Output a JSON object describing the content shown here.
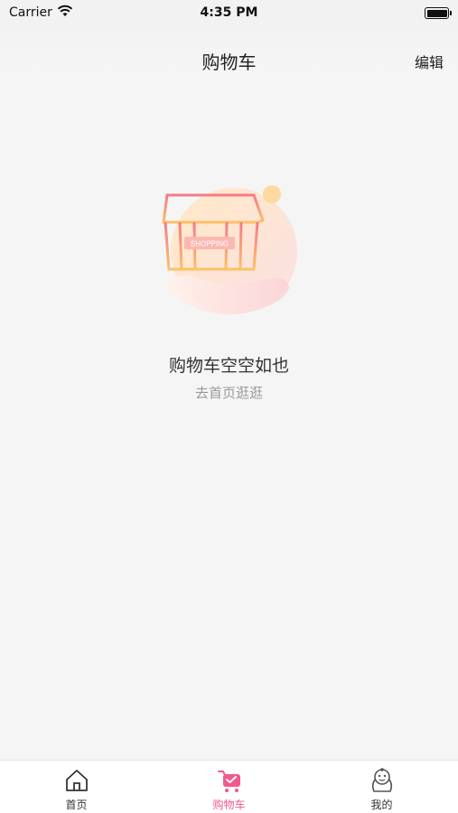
{
  "status_bar": {
    "carrier": "Carrier",
    "time": "4:35 PM"
  },
  "nav": {
    "title": "购物车",
    "edit_label": "编辑"
  },
  "empty_state": {
    "illustration_text": "SHOPPING",
    "title": "购物车空空如也",
    "link": "去首页逛逛"
  },
  "tabs": [
    {
      "label": "首页",
      "icon": "home-icon",
      "active": false
    },
    {
      "label": "购物车",
      "icon": "cart-icon",
      "active": true
    },
    {
      "label": "我的",
      "icon": "profile-icon",
      "active": false
    }
  ],
  "colors": {
    "accent": "#f2588e",
    "background": "#f5f5f5",
    "tab_bar": "#ffffff"
  }
}
